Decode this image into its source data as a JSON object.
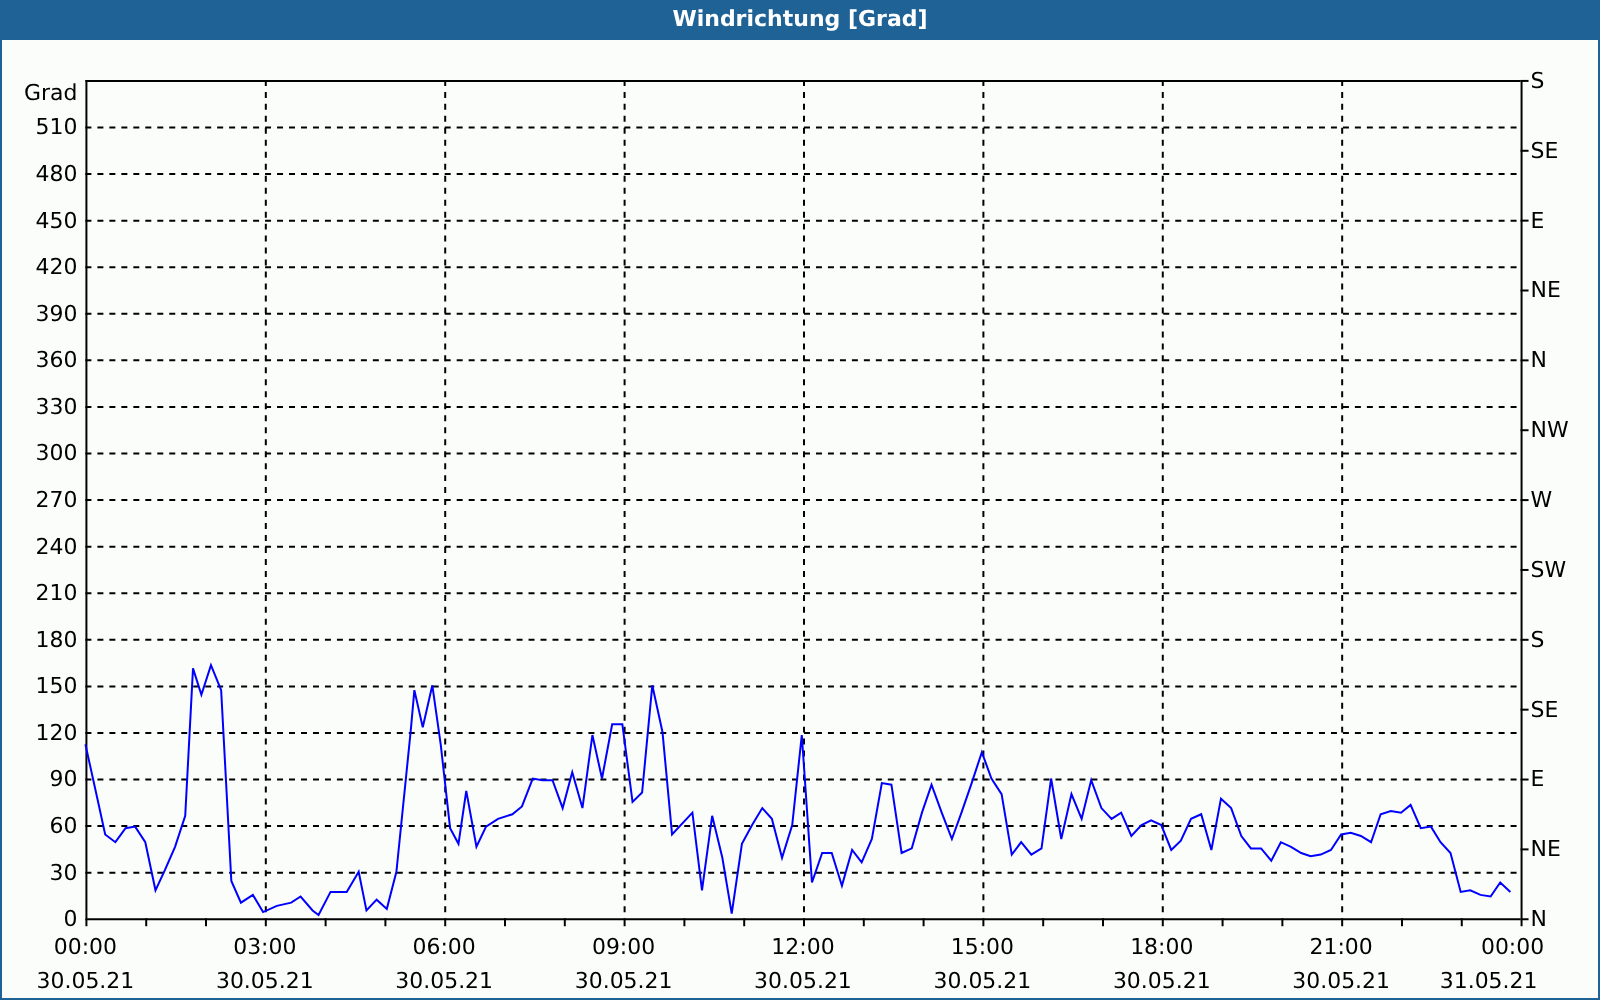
{
  "window": {
    "title": "Windrichtung [Grad]"
  },
  "chart": {
    "chart_data": {
      "type": "line",
      "ylabel": "Grad",
      "x": [
        0,
        0.2,
        0.33,
        0.5,
        0.67,
        0.83,
        1.0,
        1.17,
        1.33,
        1.5,
        1.67,
        1.8,
        1.94,
        2.1,
        2.27,
        2.44,
        2.6,
        2.8,
        2.97,
        3.2,
        3.44,
        3.6,
        3.8,
        3.9,
        4.1,
        4.37,
        4.57,
        4.7,
        4.87,
        5.04,
        5.2,
        5.44,
        5.5,
        5.64,
        5.8,
        5.94,
        6.1,
        6.24,
        6.37,
        6.54,
        6.7,
        6.9,
        7.14,
        7.3,
        7.48,
        7.64,
        7.81,
        7.98,
        8.14,
        8.31,
        8.48,
        8.64,
        8.81,
        8.98,
        9.15,
        9.31,
        9.48,
        9.65,
        9.81,
        10.15,
        10.31,
        10.48,
        10.65,
        10.81,
        10.98,
        11.15,
        11.32,
        11.48,
        11.65,
        11.82,
        11.98,
        12.15,
        12.32,
        12.48,
        12.65,
        12.82,
        12.98,
        13.15,
        13.32,
        13.48,
        13.65,
        13.82,
        13.99,
        14.15,
        14.32,
        14.49,
        14.65,
        14.82,
        14.99,
        15.15,
        15.32,
        15.49,
        15.65,
        15.82,
        15.99,
        16.15,
        16.32,
        16.49,
        16.66,
        16.82,
        16.99,
        17.16,
        17.32,
        17.49,
        17.66,
        17.82,
        17.99,
        18.16,
        18.32,
        18.49,
        18.66,
        18.83,
        18.99,
        19.16,
        19.33,
        19.49,
        19.66,
        19.83,
        19.99,
        20.16,
        20.33,
        20.49,
        20.66,
        20.83,
        21.0,
        21.16,
        21.33,
        21.5,
        21.66,
        21.83,
        22.0,
        22.16,
        22.33,
        22.5,
        22.66,
        22.83,
        23.0,
        23.16,
        23.33,
        23.5,
        23.66,
        23.83
      ],
      "series": [
        {
          "color": "#0000ff",
          "values": [
            112,
            77,
            54,
            49,
            58,
            59,
            49,
            18,
            31,
            46,
            66,
            161,
            144,
            163,
            147,
            24,
            10,
            15,
            4,
            8,
            10,
            14,
            5,
            2,
            17,
            17,
            30,
            5,
            12,
            6,
            30,
            121,
            147,
            123,
            150,
            112,
            58,
            48,
            82,
            46,
            59,
            64,
            67,
            72,
            90,
            89,
            89,
            71,
            94,
            71,
            118,
            90,
            125,
            125,
            75,
            81,
            150,
            120,
            54,
            68,
            18,
            66,
            39,
            3,
            48,
            60,
            71,
            64,
            39,
            60,
            118,
            23,
            42,
            42,
            21,
            44,
            36,
            51,
            87,
            86,
            42,
            45,
            68,
            86,
            68,
            51,
            68,
            87,
            107,
            90,
            80,
            41,
            49,
            41,
            45,
            90,
            51,
            80,
            64,
            89,
            71,
            64,
            68,
            53,
            60,
            63,
            60,
            44,
            50,
            64,
            67,
            44,
            77,
            71,
            53,
            45,
            45,
            37,
            49,
            46,
            42,
            40,
            41,
            44,
            54,
            55,
            53,
            49,
            67,
            69,
            68,
            73,
            58,
            59,
            49,
            42,
            17,
            18,
            15,
            14,
            23,
            17
          ]
        }
      ],
      "xlim": [
        0,
        24
      ],
      "ylim": [
        0,
        540
      ],
      "yticks": [
        0,
        30,
        60,
        90,
        120,
        150,
        180,
        210,
        240,
        270,
        300,
        330,
        360,
        390,
        420,
        450,
        480,
        510
      ],
      "xticks": [
        {
          "value": 0,
          "label": "00:00"
        },
        {
          "value": 3,
          "label": "03:00"
        },
        {
          "value": 6,
          "label": "06:00"
        },
        {
          "value": 9,
          "label": "09:00"
        },
        {
          "value": 12,
          "label": "12:00"
        },
        {
          "value": 15,
          "label": "15:00"
        },
        {
          "value": 18,
          "label": "18:00"
        },
        {
          "value": 21,
          "label": "21:00"
        },
        {
          "value": 24,
          "label": "00:00"
        }
      ],
      "grid": true
    },
    "direction_labels": [
      "S",
      "SE",
      "E",
      "NE",
      "N",
      "NW",
      "W",
      "SW",
      "S",
      "SE",
      "E",
      "NE",
      "N"
    ],
    "x_dates": [
      "30.05.21",
      "30.05.21",
      "30.05.21",
      "30.05.21",
      "30.05.21",
      "30.05.21",
      "30.05.21",
      "30.05.21",
      "31.05.21"
    ]
  }
}
